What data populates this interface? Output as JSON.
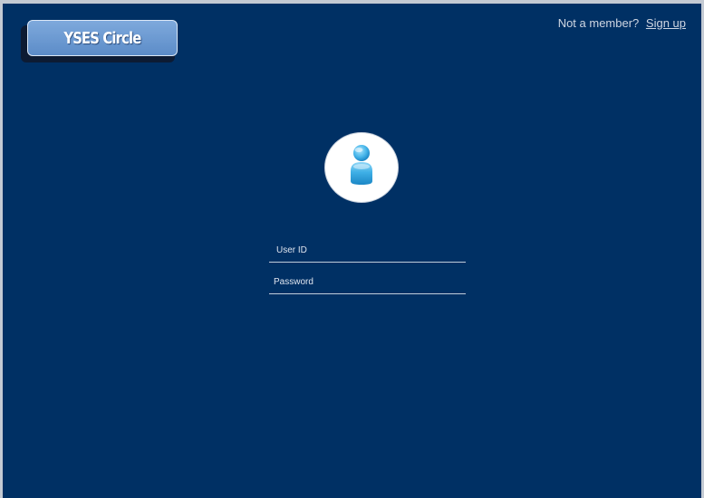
{
  "header": {
    "logo_text": "YSES Circle",
    "member_prompt": "Not a member?",
    "signup_label": "Sign up"
  },
  "login": {
    "avatar_icon": "user-avatar-icon",
    "userid_placeholder": "User ID",
    "userid_value": "",
    "password_placeholder": "Password",
    "password_value": ""
  },
  "colors": {
    "background": "#003064",
    "logo_fill": "#6b9ad3",
    "avatar_blue": "#3aaee4"
  }
}
